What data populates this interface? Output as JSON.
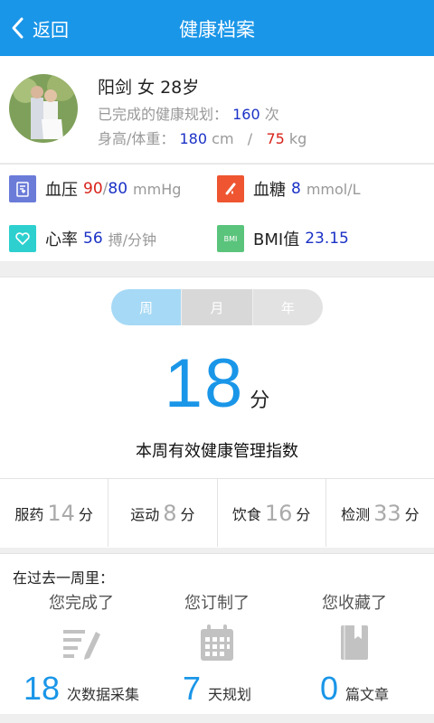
{
  "header": {
    "back_label": "返回",
    "title": "健康档案"
  },
  "profile": {
    "name_line": "阳剑 女 28岁",
    "plans_label": "已完成的健康规划：",
    "plans_count": "160",
    "plans_unit": "次",
    "body_label": "身高/体重：",
    "height": "180",
    "height_unit": "cm",
    "separator": "/",
    "weight": "75",
    "weight_unit": "kg"
  },
  "vitals": {
    "bp": {
      "label": "血压",
      "systolic": "90",
      "slash": "/",
      "diastolic": "80",
      "unit": "mmHg"
    },
    "glucose": {
      "label": "血糖",
      "value": "8",
      "unit": "mmol/L"
    },
    "heart": {
      "label": "心率",
      "value": "56",
      "unit": "搏/分钟"
    },
    "bmi": {
      "icon_text": "BMI",
      "label": "BMI值",
      "value": "23.15"
    }
  },
  "period_tabs": {
    "items": [
      "周",
      "月",
      "年"
    ],
    "selected": "周"
  },
  "score": {
    "value": "18",
    "unit": "分",
    "caption": "本周有效健康管理指数"
  },
  "categories": [
    {
      "label": "服药",
      "value": "14",
      "unit": "分"
    },
    {
      "label": "运动",
      "value": "8",
      "unit": "分"
    },
    {
      "label": "饮食",
      "value": "16",
      "unit": "分"
    },
    {
      "label": "检测",
      "value": "33",
      "unit": "分"
    }
  ],
  "week": {
    "heading": "在过去一周里：",
    "columns": [
      {
        "title": "您完成了",
        "icon": "edit-list-icon",
        "value": "18",
        "text": "次数据采集"
      },
      {
        "title": "您订制了",
        "icon": "calendar-icon",
        "value": "7",
        "text": "天规划"
      },
      {
        "title": "您收藏了",
        "icon": "book-icon",
        "value": "0",
        "text": "篇文章"
      }
    ]
  },
  "colors": {
    "accent": "#1a96e8",
    "blue_value": "#1a31c6",
    "red_value": "#d8231b"
  }
}
